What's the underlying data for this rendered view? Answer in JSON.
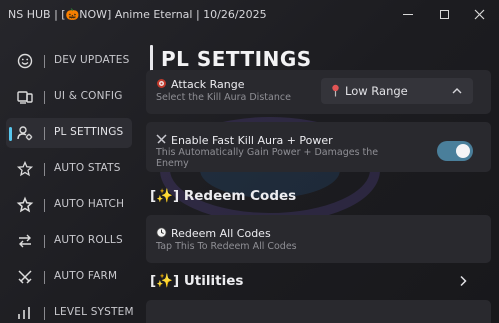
{
  "window": {
    "title": "NS HUB  |  [🎃NOW] Anime Eternal | 10/26/2025",
    "controls": [
      "minimize-icon",
      "maximize-icon",
      "close-icon"
    ]
  },
  "sidebar": {
    "items": [
      {
        "label": "DEV UPDATES",
        "icon": "smiley-icon",
        "active": false
      },
      {
        "label": "UI & CONFIG",
        "icon": "devices-icon",
        "active": false
      },
      {
        "label": "PL SETTINGS",
        "icon": "user-gear-icon",
        "active": true
      },
      {
        "label": "AUTO STATS",
        "icon": "star-outline-icon",
        "active": false
      },
      {
        "label": "AUTO HATCH",
        "icon": "star-icon",
        "active": false
      },
      {
        "label": "AUTO ROLLS",
        "icon": "swap-arrows-icon",
        "active": false
      },
      {
        "label": "AUTO FARM",
        "icon": "crossed-swords-icon",
        "active": false
      },
      {
        "label": "LEVEL SYSTEM",
        "icon": "level-icon",
        "active": false
      }
    ],
    "accent_color": "#58c7ee"
  },
  "main": {
    "page_title": "PL SETTINGS",
    "attack_range": {
      "title": "Attack Range",
      "subtitle": "Select the Kill Aura Distance",
      "value": "Low Range"
    },
    "fast_kill": {
      "title": "Enable Fast Kill Aura + Power",
      "subtitle": "This Automatically Gain Power + Damages the Enemy",
      "enabled": true,
      "toggle_color": "#4a7f9b"
    },
    "redeem_section": "[✨] Redeem Codes",
    "redeem_all": {
      "title": "Redeem All Codes",
      "subtitle": "Tap This To Redeem All Codes"
    },
    "utilities_section": "[✨] Utilities"
  }
}
